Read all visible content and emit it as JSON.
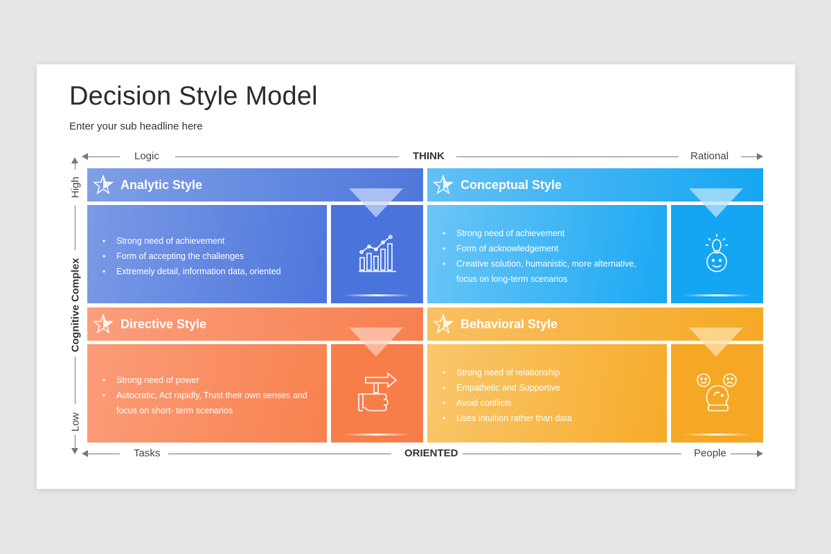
{
  "title": "Decision Style Model",
  "subtitle": "Enter your sub headline here",
  "axes": {
    "top_left": "Logic",
    "top_center": "THINK",
    "top_right": "Rational",
    "bottom_left": "Tasks",
    "bottom_center": "ORIENTED",
    "bottom_right": "People",
    "left_top": "High",
    "left_center": "Cognitive Complex",
    "left_bottom": "Low"
  },
  "quadrants": {
    "analytic": {
      "title": "Analytic Style",
      "icon": "bar-chart-icon",
      "bullets": [
        "Strong need of achievement",
        "Form of accepting the challenges",
        "Extremely detail, information data, oriented"
      ]
    },
    "conceptual": {
      "title": "Conceptual Style",
      "icon": "idea-head-icon",
      "bullets": [
        "Strong need of achievement",
        "Form of acknowledgement",
        "Creative solution, humanistic, more alternative,",
        "focus on long-term scenarios"
      ]
    },
    "directive": {
      "title": "Directive Style",
      "icon": "hand-sign-icon",
      "bullets": [
        "Strong need of power",
        "Autocratic, Act rapidly, Trust their own senses and",
        "focus on short- term scenarios"
      ]
    },
    "behavioral": {
      "title": "Behavioral Style",
      "icon": "emotions-head-icon",
      "bullets": [
        "Strong need of relationship",
        "Empathetic and Supportive",
        "Avoid conflicts",
        "Uses intuition rather than data"
      ]
    }
  },
  "colors": {
    "analytic": "#4f78dc",
    "conceptual": "#29aaf2",
    "directive": "#f9845a",
    "behavioral": "#f8ad2c"
  }
}
